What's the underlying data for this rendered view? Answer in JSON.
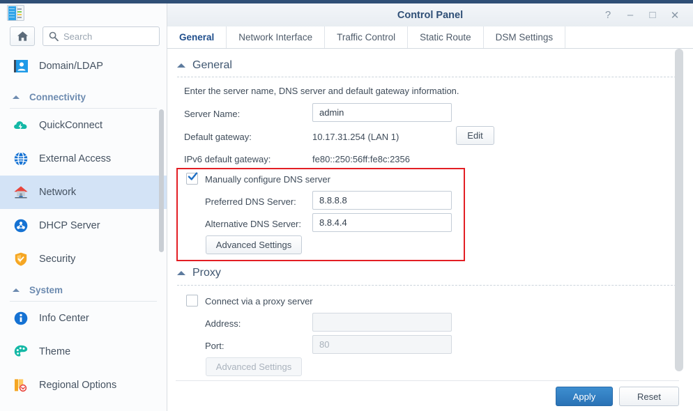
{
  "window": {
    "title": "Control Panel",
    "app_icon": "control-panel-icon",
    "controls": [
      {
        "name": "help-button",
        "glyph": "?"
      },
      {
        "name": "minimize-button",
        "glyph": "–"
      },
      {
        "name": "maximize-button",
        "glyph": "□"
      },
      {
        "name": "close-button",
        "glyph": "✕"
      }
    ]
  },
  "sidebar": {
    "home_icon": "home-icon",
    "search": {
      "placeholder": "Search",
      "value": ""
    },
    "top_items": [
      {
        "label": "Domain/LDAP",
        "icon": "domain-ldap-icon",
        "active": false
      }
    ],
    "groups": [
      {
        "label": "Connectivity",
        "items": [
          {
            "label": "QuickConnect",
            "icon": "quickconnect-icon",
            "active": false
          },
          {
            "label": "External Access",
            "icon": "external-access-icon",
            "active": false
          },
          {
            "label": "Network",
            "icon": "network-icon",
            "active": true
          },
          {
            "label": "DHCP Server",
            "icon": "dhcp-server-icon",
            "active": false
          },
          {
            "label": "Security",
            "icon": "security-icon",
            "active": false
          }
        ]
      },
      {
        "label": "System",
        "items": [
          {
            "label": "Info Center",
            "icon": "info-center-icon",
            "active": false
          },
          {
            "label": "Theme",
            "icon": "theme-icon",
            "active": false
          },
          {
            "label": "Regional Options",
            "icon": "regional-options-icon",
            "active": false
          }
        ]
      }
    ]
  },
  "tabs": [
    {
      "label": "General",
      "active": true
    },
    {
      "label": "Network Interface",
      "active": false
    },
    {
      "label": "Traffic Control",
      "active": false
    },
    {
      "label": "Static Route",
      "active": false
    },
    {
      "label": "DSM Settings",
      "active": false
    }
  ],
  "general": {
    "section_title": "General",
    "description": "Enter the server name, DNS server and default gateway information.",
    "server_name_label": "Server Name:",
    "server_name_value": "admin",
    "default_gateway_label": "Default gateway:",
    "default_gateway_value": "10.17.31.254 (LAN 1)",
    "edit_button": "Edit",
    "ipv6_gateway_label": "IPv6 default gateway:",
    "ipv6_gateway_value": "fe80::250:56ff:fe8c:2356"
  },
  "dns": {
    "checkbox_label": "Manually configure DNS server",
    "checked": true,
    "preferred_label": "Preferred DNS Server:",
    "preferred_value": "8.8.8.8",
    "alternative_label": "Alternative DNS Server:",
    "alternative_value": "8.8.4.4",
    "advanced_button": "Advanced Settings",
    "highlight_color": "#e31e24"
  },
  "proxy": {
    "section_title": "Proxy",
    "checkbox_label": "Connect via a proxy server",
    "checked": false,
    "address_label": "Address:",
    "address_value": "",
    "address_placeholder": "",
    "port_label": "Port:",
    "port_value": "",
    "port_placeholder": "80",
    "advanced_button": "Advanced Settings"
  },
  "footer": {
    "apply_label": "Apply",
    "reset_label": "Reset"
  },
  "colors": {
    "accent": "#2f4f76",
    "primary_button": "#2a72b5",
    "active_item": "#d3e3f6",
    "highlight": "#e31e24"
  }
}
